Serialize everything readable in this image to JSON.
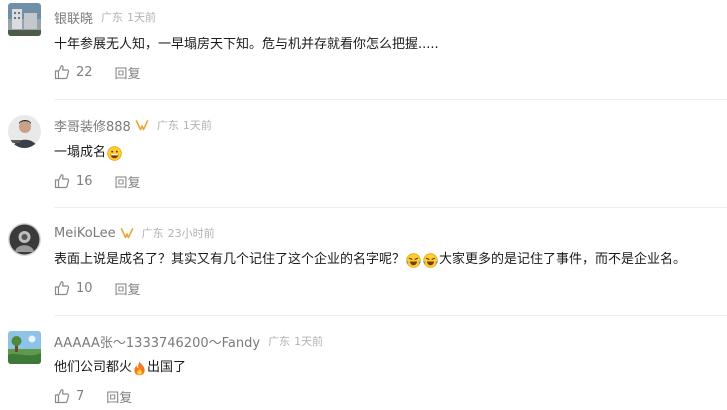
{
  "comments": [
    {
      "username": "银联晓",
      "location": "广东",
      "time": "1天前",
      "text": "十年参展无人知，一早塌房天下知。危与机并存就看你怎么把握.....",
      "likes": "22",
      "reply": "回复"
    },
    {
      "username": "李哥装修888",
      "location": "广东",
      "time": "1天前",
      "text_before": "一塌成名",
      "text_after": "",
      "likes": "16",
      "reply": "回复"
    },
    {
      "username": "MeiKoLee",
      "location": "广东",
      "time": "23小时前",
      "text_before": "表面上说是成名了？其实又有几个记住了这个企业的名字呢？",
      "text_after": " 大家更多的是记住了事件，而不是企业名。",
      "likes": "10",
      "reply": "回复"
    },
    {
      "username": "AAAAA张～1333746200～Fandy",
      "location": "广东",
      "time": "1天前",
      "text_before": "他们公司都火",
      "text_after": "出国了",
      "likes": "7",
      "reply": "回复"
    }
  ],
  "icons": {
    "like": "thumbs-up-icon",
    "badge": "v-badge-icon",
    "grin": "grinning-face-emoji",
    "laugh": "laughing-tears-emoji",
    "fire": "fire-emoji"
  },
  "colors": {
    "username": "#7a7a7a",
    "meta": "#b2b2b2",
    "action": "#808080",
    "badge": "#f0a33a"
  }
}
